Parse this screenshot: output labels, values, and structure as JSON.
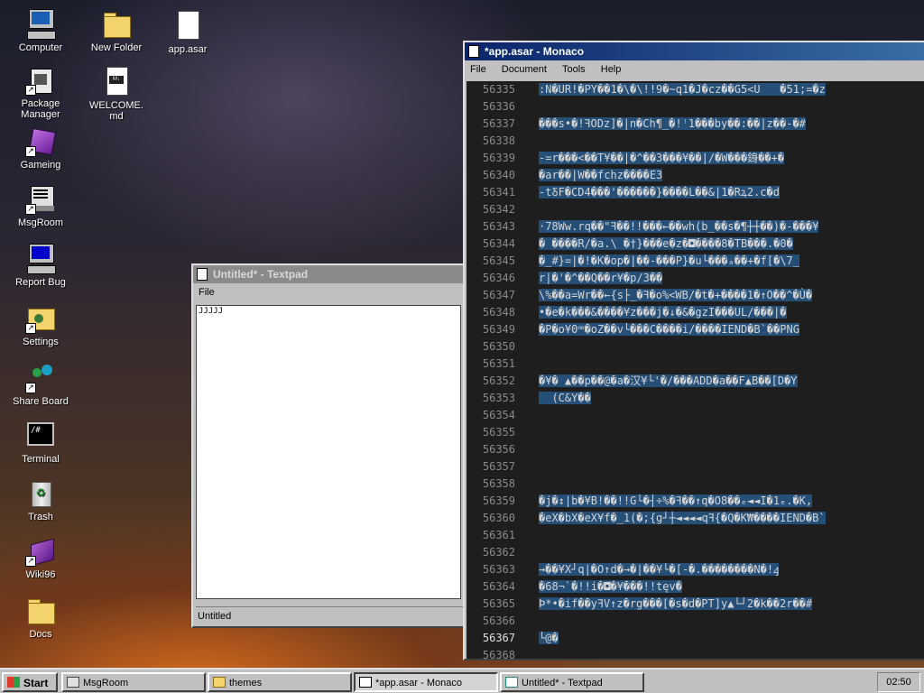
{
  "desktop": {
    "icons": [
      {
        "label": "Computer"
      },
      {
        "label": "Package Manager"
      },
      {
        "label": "Gameing"
      },
      {
        "label": "MsgRoom"
      },
      {
        "label": "Report Bug"
      },
      {
        "label": "Settings"
      },
      {
        "label": "Share Board"
      },
      {
        "label": "Terminal"
      },
      {
        "label": "Trash"
      },
      {
        "label": "Wiki96"
      },
      {
        "label": "Docs"
      },
      {
        "label": "New Folder"
      },
      {
        "label": "WELCOME.md"
      },
      {
        "label": "app.asar"
      }
    ]
  },
  "textpad": {
    "title": "Untitled* - Textpad",
    "menu": [
      "File"
    ],
    "content": "JJJJJ",
    "status": "Untitled"
  },
  "monaco": {
    "title": "*app.asar - Monaco",
    "menu": [
      "File",
      "Document",
      "Tools",
      "Help"
    ],
    "lines": [
      {
        "n": "56335",
        "t": ":N�UR!�PY��1�\\�\\!!9�~q1�J�cz��G5<U   �51;=�z"
      },
      {
        "n": "56336",
        "t": ""
      },
      {
        "n": "56337",
        "t": "���s•�!ꟻODz]�|n�Ch¶_�!ꜝ1���by��:��|z��-�#"
      },
      {
        "n": "56338",
        "t": ""
      },
      {
        "n": "56339",
        "t": "-=r���<��T¥��|�^��3���¥��|/�W���銵��+�"
      },
      {
        "n": "56340",
        "t": "�ar��|W��fchz����E3"
      },
      {
        "n": "56341",
        "t": "-tꝽF�CD4���'������}����L��&|1�Rꝝ2.c�d"
      },
      {
        "n": "56342",
        "t": ""
      },
      {
        "n": "56343",
        "t": "·78Ww.rq��\"ꟻ��!!���←��wh(b_��s�¶┼┼��)�-���¥"
      },
      {
        "n": "56344",
        "t": "� ����R/�a.\\ �†}���e�z�◘����8�TB���.�0�"
      },
      {
        "n": "56345",
        "t": "�_#}=|�!�K�op�|��-���P}�u└���ₐ��+�f[�\\7_"
      },
      {
        "n": "56346",
        "t": "r|�'�^��Q��r¥�p/3��"
      },
      {
        "n": "56347",
        "t": "\\%��a=Wr��←{s├_�ꟻ�o%<WB/�t�+����1�↑O��^�Ù�"
      },
      {
        "n": "56348",
        "t": "•�e�k���&����¥z���j�↓�&�gzI���UL/���|�"
      },
      {
        "n": "56349",
        "t": "�P�o¥0ꟹ�oZ��v└���C����i/����IEND�B`��PNG"
      },
      {
        "n": "56350",
        "t": ""
      },
      {
        "n": "56351",
        "t": ""
      },
      {
        "n": "56352",
        "t": "�¥� ▲��p��@�a�汉¥└'�/���ADD�a��F▲B��[D�Y"
      },
      {
        "n": "56353",
        "t": "  (C&Y��"
      },
      {
        "n": "56354",
        "t": ""
      },
      {
        "n": "56355",
        "t": ""
      },
      {
        "n": "56356",
        "t": ""
      },
      {
        "n": "56357",
        "t": ""
      },
      {
        "n": "56358",
        "t": ""
      },
      {
        "n": "56359",
        "t": "�j�↕|b�¥B!��!!G└�┤÷%�ꟻ��↑q�O8��ₑ◄◄I�1ₑ.�K,"
      },
      {
        "n": "56360",
        "t": "�eX�bX�eX¥f�_1(�;{g┘┼◄◄◄◄qꟻ{�Q�K₩����IEND�B`"
      },
      {
        "n": "56361",
        "t": ""
      },
      {
        "n": "56362",
        "t": ""
      },
      {
        "n": "56363",
        "t": "→��¥X┘q|�O↑d�→�|��¥└�[-�.��������N�!ꜭ"
      },
      {
        "n": "56364",
        "t": "�68¬`�!!i�◘�¥���!!tęv�"
      },
      {
        "n": "56365",
        "t": "Þ*•�if��yꟻV↑z�rg���[�s�d�PT]y▲└┘2�k��2r��#"
      },
      {
        "n": "56366",
        "t": ""
      },
      {
        "n": "56367",
        "t": "└@�"
      },
      {
        "n": "56368",
        "t": ""
      }
    ]
  },
  "taskbar": {
    "start": "Start",
    "items": [
      "MsgRoom",
      "themes",
      "*app.asar - Monaco",
      "Untitled* - Textpad"
    ],
    "clock": "02:50"
  },
  "colors": {
    "titlebar_active": "#0a246a",
    "titlebar_inactive": "#8a8a8a",
    "editor_bg": "#1e1e1e",
    "selection": "#264f78"
  }
}
